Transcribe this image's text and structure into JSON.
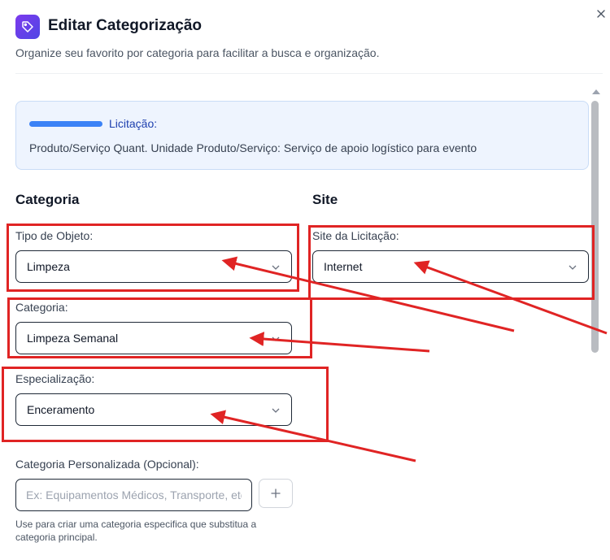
{
  "dialog": {
    "title": "Editar Categorização",
    "subtitle": "Organize seu favorito por categoria para facilitar a busca e organização."
  },
  "info_card": {
    "label": "Licitação:",
    "text": "Produto/Serviço Quant. Unidade Produto/Serviço: Serviço de apoio logístico para evento",
    "accent_color": "#3b82f6"
  },
  "categoria_section": {
    "heading": "Categoria",
    "tipo_objeto": {
      "label": "Tipo de Objeto:",
      "value": "Limpeza"
    },
    "categoria": {
      "label": "Categoria:",
      "value": "Limpeza Semanal"
    },
    "especializacao": {
      "label": "Especialização:",
      "value": "Enceramento"
    },
    "personalizada": {
      "label": "Categoria Personalizada (Opcional):",
      "placeholder": "Ex: Equipamentos Médicos, Transporte, etc.",
      "helper": "Use para criar uma categoria especifica que substitua a categoria principal."
    }
  },
  "site_section": {
    "heading": "Site",
    "site_licitacao": {
      "label": "Site da Licitação:",
      "value": "Internet"
    }
  },
  "icons": {
    "app": "tag-icon",
    "close": "close-icon",
    "dropdown": "chevron-down-icon",
    "add": "plus-icon"
  },
  "annotation_color": "#e02424"
}
